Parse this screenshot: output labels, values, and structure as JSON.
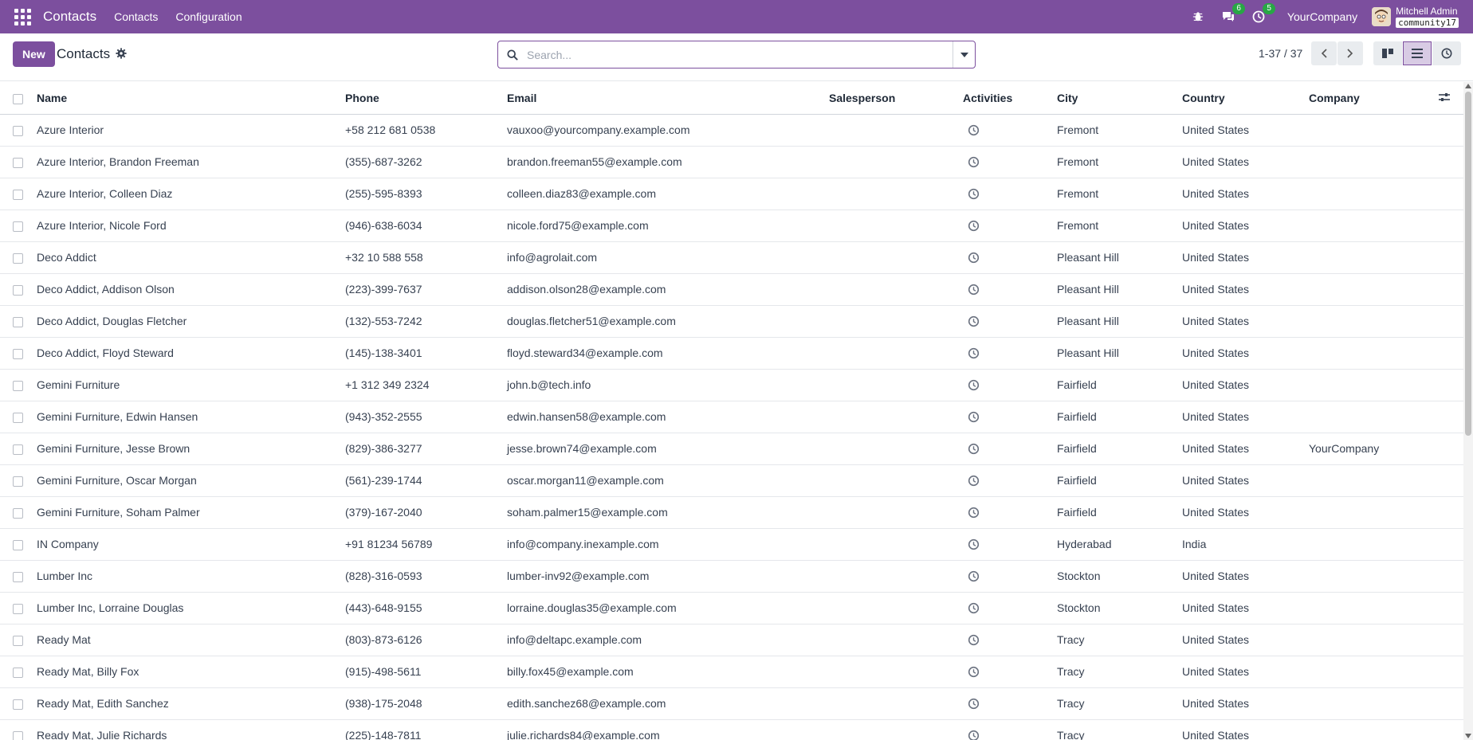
{
  "navbar": {
    "app_name": "Contacts",
    "menu": [
      "Contacts",
      "Configuration"
    ],
    "messages_count": "6",
    "activities_count": "5",
    "company": "YourCompany",
    "user_name": "Mitchell Admin",
    "database": "community17"
  },
  "control_panel": {
    "new_label": "New",
    "title": "Contacts",
    "search_placeholder": "Search...",
    "pager": "1-37 / 37"
  },
  "colors": {
    "brand": "#7c4f9e",
    "badge": "#28a745"
  },
  "table": {
    "columns": [
      "Name",
      "Phone",
      "Email",
      "Salesperson",
      "Activities",
      "City",
      "Country",
      "Company"
    ],
    "rows": [
      {
        "name": "Azure Interior",
        "phone": "+58 212 681 0538",
        "email": "vauxoo@yourcompany.example.com",
        "salesperson": "",
        "city": "Fremont",
        "country": "United States",
        "company": ""
      },
      {
        "name": "Azure Interior, Brandon Freeman",
        "phone": "(355)-687-3262",
        "email": "brandon.freeman55@example.com",
        "salesperson": "",
        "city": "Fremont",
        "country": "United States",
        "company": ""
      },
      {
        "name": "Azure Interior, Colleen Diaz",
        "phone": "(255)-595-8393",
        "email": "colleen.diaz83@example.com",
        "salesperson": "",
        "city": "Fremont",
        "country": "United States",
        "company": ""
      },
      {
        "name": "Azure Interior, Nicole Ford",
        "phone": "(946)-638-6034",
        "email": "nicole.ford75@example.com",
        "salesperson": "",
        "city": "Fremont",
        "country": "United States",
        "company": ""
      },
      {
        "name": "Deco Addict",
        "phone": "+32 10 588 558",
        "email": "info@agrolait.com",
        "salesperson": "",
        "city": "Pleasant Hill",
        "country": "United States",
        "company": ""
      },
      {
        "name": "Deco Addict, Addison Olson",
        "phone": "(223)-399-7637",
        "email": "addison.olson28@example.com",
        "salesperson": "",
        "city": "Pleasant Hill",
        "country": "United States",
        "company": ""
      },
      {
        "name": "Deco Addict, Douglas Fletcher",
        "phone": "(132)-553-7242",
        "email": "douglas.fletcher51@example.com",
        "salesperson": "",
        "city": "Pleasant Hill",
        "country": "United States",
        "company": ""
      },
      {
        "name": "Deco Addict, Floyd Steward",
        "phone": "(145)-138-3401",
        "email": "floyd.steward34@example.com",
        "salesperson": "",
        "city": "Pleasant Hill",
        "country": "United States",
        "company": ""
      },
      {
        "name": "Gemini Furniture",
        "phone": "+1 312 349 2324",
        "email": "john.b@tech.info",
        "salesperson": "",
        "city": "Fairfield",
        "country": "United States",
        "company": ""
      },
      {
        "name": "Gemini Furniture, Edwin Hansen",
        "phone": "(943)-352-2555",
        "email": "edwin.hansen58@example.com",
        "salesperson": "",
        "city": "Fairfield",
        "country": "United States",
        "company": ""
      },
      {
        "name": "Gemini Furniture, Jesse Brown",
        "phone": "(829)-386-3277",
        "email": "jesse.brown74@example.com",
        "salesperson": "",
        "city": "Fairfield",
        "country": "United States",
        "company": "YourCompany"
      },
      {
        "name": "Gemini Furniture, Oscar Morgan",
        "phone": "(561)-239-1744",
        "email": "oscar.morgan11@example.com",
        "salesperson": "",
        "city": "Fairfield",
        "country": "United States",
        "company": ""
      },
      {
        "name": "Gemini Furniture, Soham Palmer",
        "phone": "(379)-167-2040",
        "email": "soham.palmer15@example.com",
        "salesperson": "",
        "city": "Fairfield",
        "country": "United States",
        "company": ""
      },
      {
        "name": "IN Company",
        "phone": "+91 81234 56789",
        "email": "info@company.inexample.com",
        "salesperson": "",
        "city": "Hyderabad",
        "country": "India",
        "company": ""
      },
      {
        "name": "Lumber Inc",
        "phone": "(828)-316-0593",
        "email": "lumber-inv92@example.com",
        "salesperson": "",
        "city": "Stockton",
        "country": "United States",
        "company": ""
      },
      {
        "name": "Lumber Inc, Lorraine Douglas",
        "phone": "(443)-648-9155",
        "email": "lorraine.douglas35@example.com",
        "salesperson": "",
        "city": "Stockton",
        "country": "United States",
        "company": ""
      },
      {
        "name": "Ready Mat",
        "phone": "(803)-873-6126",
        "email": "info@deltapc.example.com",
        "salesperson": "",
        "city": "Tracy",
        "country": "United States",
        "company": ""
      },
      {
        "name": "Ready Mat, Billy Fox",
        "phone": "(915)-498-5611",
        "email": "billy.fox45@example.com",
        "salesperson": "",
        "city": "Tracy",
        "country": "United States",
        "company": ""
      },
      {
        "name": "Ready Mat, Edith Sanchez",
        "phone": "(938)-175-2048",
        "email": "edith.sanchez68@example.com",
        "salesperson": "",
        "city": "Tracy",
        "country": "United States",
        "company": ""
      },
      {
        "name": "Ready Mat, Julie Richards",
        "phone": "(225)-148-7811",
        "email": "julie.richards84@example.com",
        "salesperson": "",
        "city": "Tracy",
        "country": "United States",
        "company": ""
      }
    ]
  }
}
